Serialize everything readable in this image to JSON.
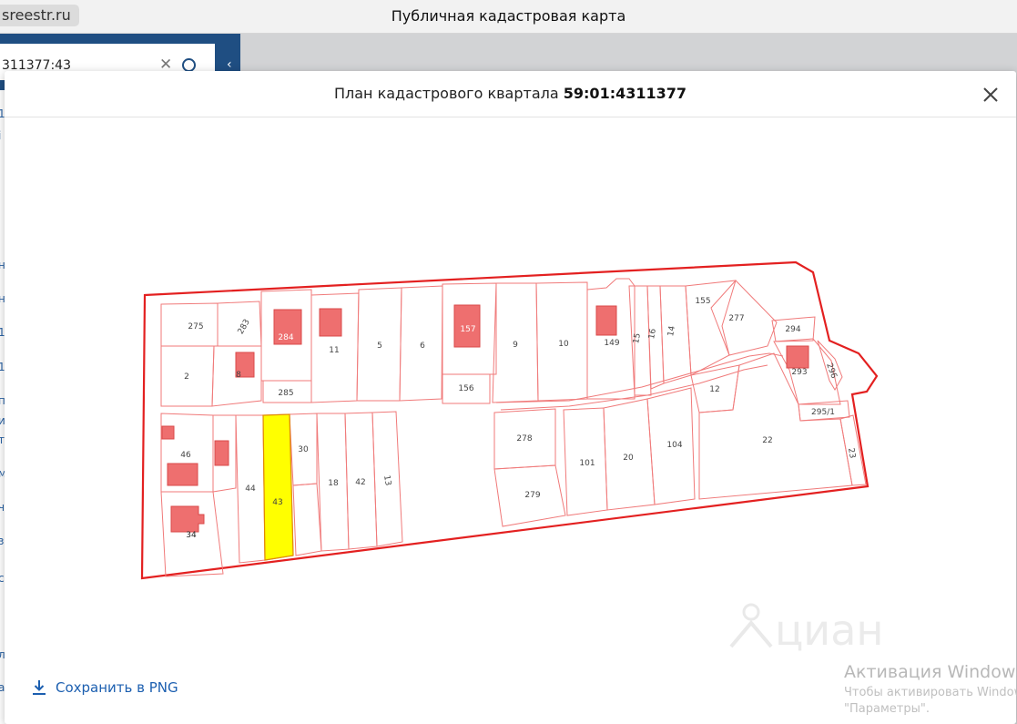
{
  "browser": {
    "url_fragment": "sreestr.ru",
    "window_title": "Публичная кадастровая карта"
  },
  "background_panel": {
    "search_value": "311377:43",
    "edge_letters": [
      "1",
      "i",
      "н",
      "н",
      "1",
      "1",
      "п",
      "и",
      "т",
      "м",
      "ч",
      "з",
      "с",
      "л",
      "а"
    ]
  },
  "modal": {
    "title_prefix": "План кадастрового квартала",
    "title_number": "59:01:4311377",
    "save_label": "Сохранить в PNG"
  },
  "map": {
    "highlighted_parcel": "43",
    "parcel_labels": [
      "275",
      "283",
      "284",
      "11",
      "5",
      "6",
      "157",
      "9",
      "10",
      "149",
      "15",
      "16",
      "14",
      "155",
      "277",
      "294",
      "2",
      "8",
      "285",
      "156",
      "293",
      "296",
      "12",
      "295/1",
      "46",
      "30",
      "18",
      "42",
      "13",
      "278",
      "101",
      "20",
      "104",
      "22",
      "23",
      "44",
      "43",
      "279",
      "34"
    ],
    "colors": {
      "boundary": "#e02020",
      "building_fill": "#ee6f6f",
      "highlight_fill": "#ffff00"
    }
  },
  "watermark": {
    "logo_text": "циан",
    "activation_title": "Активация Windows",
    "activation_line1": "Чтобы активировать Windows,",
    "activation_line2": "\"Параметры\"."
  }
}
